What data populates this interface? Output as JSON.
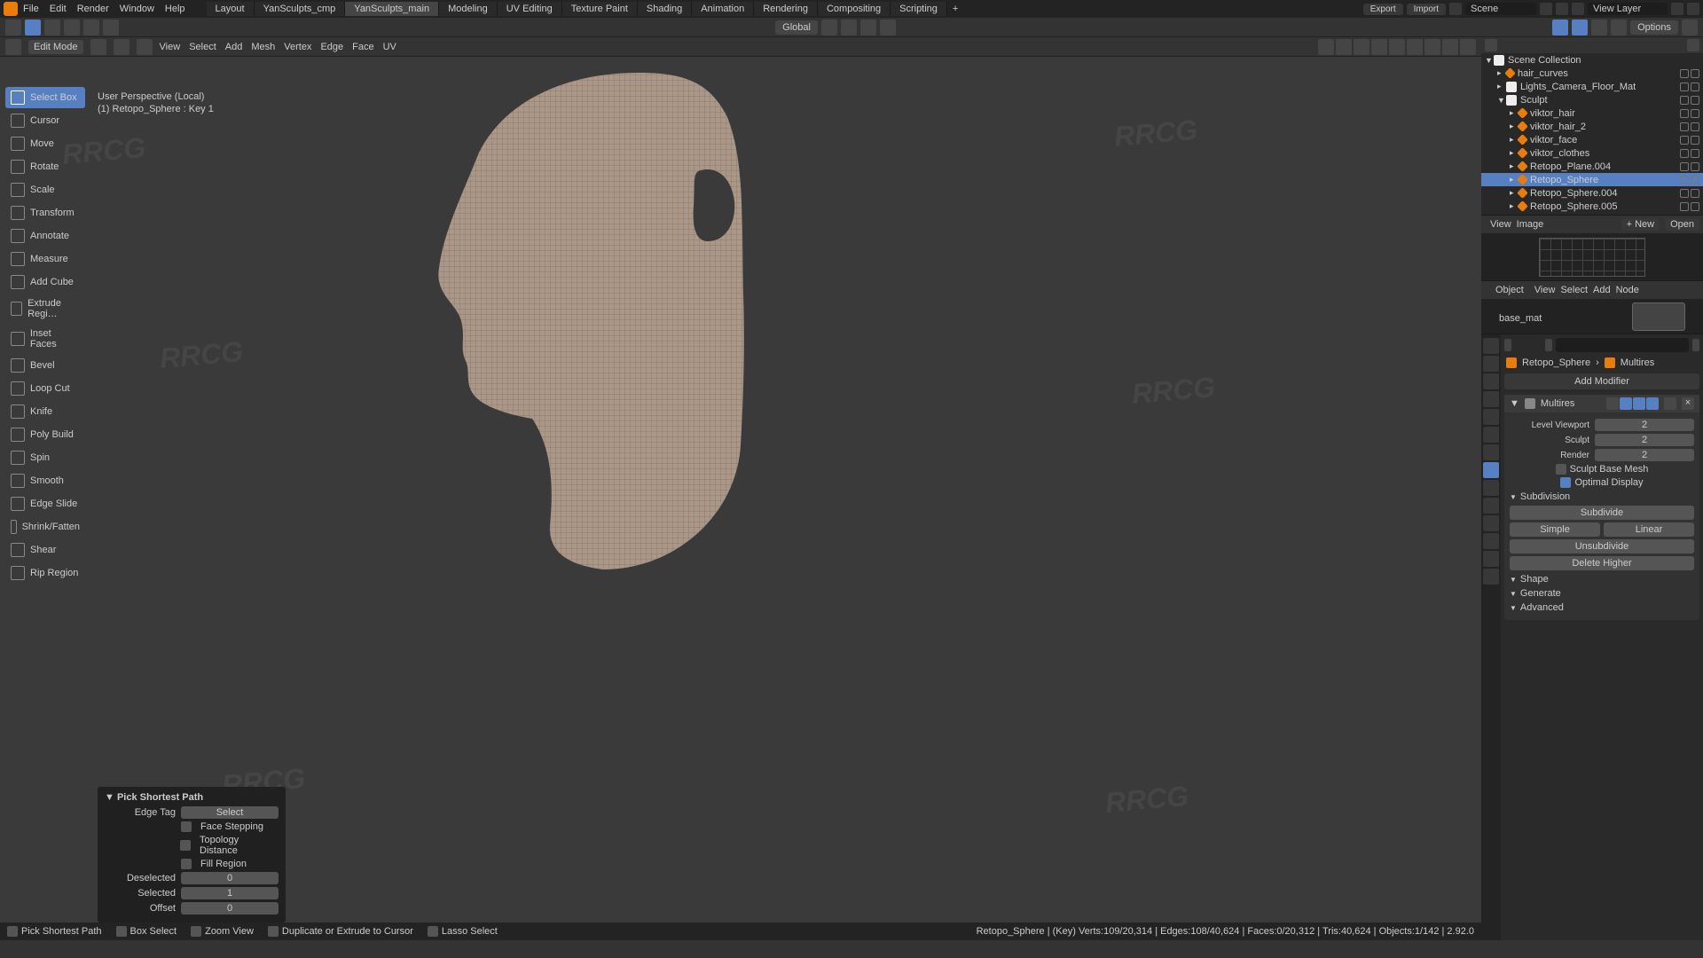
{
  "top_menu": [
    "File",
    "Edit",
    "Render",
    "Window",
    "Help"
  ],
  "workspace_tabs": [
    "Layout",
    "YanSculpts_cmp",
    "YanSculpts_main",
    "Modeling",
    "UV Editing",
    "Texture Paint",
    "Shading",
    "Animation",
    "Rendering",
    "Compositing",
    "Scripting"
  ],
  "active_tab": "YanSculpts_main",
  "export_btn": "Export",
  "import_btn": "Import",
  "scene_field": "Scene",
  "view_layer_field": "View Layer",
  "secondbar": {
    "orientation": "Global",
    "options": "Options"
  },
  "viewport_header": {
    "mode": "Edit Mode",
    "menus": [
      "View",
      "Select",
      "Add",
      "Mesh",
      "Vertex",
      "Edge",
      "Face",
      "UV"
    ]
  },
  "perspective": {
    "line1": "User Perspective (Local)",
    "line2": "(1) Retopo_Sphere : Key 1"
  },
  "tools": [
    "Select Box",
    "Cursor",
    "Move",
    "Rotate",
    "Scale",
    "Transform",
    "Annotate",
    "Measure",
    "Add Cube",
    "Extrude Regi…",
    "Inset Faces",
    "Bevel",
    "Loop Cut",
    "Knife",
    "Poly Build",
    "Spin",
    "Smooth",
    "Edge Slide",
    "Shrink/Fatten",
    "Shear",
    "Rip Region"
  ],
  "active_tool": "Select Box",
  "operator": {
    "title": "Pick Shortest Path",
    "edge_tag": "Edge Tag",
    "edge_tag_val": "Select",
    "face_stepping": "Face Stepping",
    "topology_distance": "Topology Distance",
    "fill_region": "Fill Region",
    "deselected": "Deselected",
    "deselected_val": "0",
    "selected": "Selected",
    "selected_val": "1",
    "offset": "Offset",
    "offset_val": "0"
  },
  "status": {
    "items": [
      "Pick Shortest Path",
      "Box Select",
      "Zoom View",
      "Duplicate or Extrude to Cursor",
      "Lasso Select"
    ],
    "right": "Retopo_Sphere  |  (Key) Verts:109/20,314  |  Edges:108/40,624  |  Faces:0/20,312  |  Tris:40,624  |  Objects:1/142  |  2.92.0"
  },
  "outliner_hdr": "Scene Collection",
  "outliner": [
    {
      "name": "hair_curves",
      "ind": 1,
      "type": "obj"
    },
    {
      "name": "Lights_Camera_Floor_Mat",
      "ind": 1,
      "type": "coll"
    },
    {
      "name": "Sculpt",
      "ind": 1,
      "type": "coll",
      "exp": true
    },
    {
      "name": "viktor_hair",
      "ind": 2,
      "type": "obj"
    },
    {
      "name": "viktor_hair_2",
      "ind": 2,
      "type": "obj"
    },
    {
      "name": "viktor_face",
      "ind": 2,
      "type": "obj"
    },
    {
      "name": "viktor_clothes",
      "ind": 2,
      "type": "obj"
    },
    {
      "name": "Retopo_Plane.004",
      "ind": 2,
      "type": "obj"
    },
    {
      "name": "Retopo_Sphere",
      "ind": 2,
      "type": "obj",
      "sel": true
    },
    {
      "name": "Retopo_Sphere.004",
      "ind": 2,
      "type": "obj"
    },
    {
      "name": "Retopo_Sphere.005",
      "ind": 2,
      "type": "obj"
    }
  ],
  "image_editor": {
    "menus": [
      "View",
      "Image"
    ],
    "new": "New",
    "open": "Open"
  },
  "node_editor": {
    "menus": [
      "Object",
      "View",
      "Select",
      "Add",
      "Node"
    ],
    "material": "base_mat"
  },
  "props": {
    "breadcrumb": [
      "Retopo_Sphere",
      "Multires"
    ],
    "add_modifier": "Add Modifier",
    "modifier_name": "Multires",
    "level_viewport": "Level Viewport",
    "level_viewport_val": "2",
    "sculpt": "Sculpt",
    "sculpt_val": "2",
    "render": "Render",
    "render_val": "2",
    "sculpt_base_mesh": "Sculpt Base Mesh",
    "optimal_display": "Optimal Display",
    "subdivision": "Subdivision",
    "subdivide": "Subdivide",
    "simple": "Simple",
    "linear": "Linear",
    "unsubdivide": "Unsubdivide",
    "delete_higher": "Delete Higher",
    "sections": [
      "Shape",
      "Generate",
      "Advanced"
    ]
  },
  "watermark": "RRCG"
}
